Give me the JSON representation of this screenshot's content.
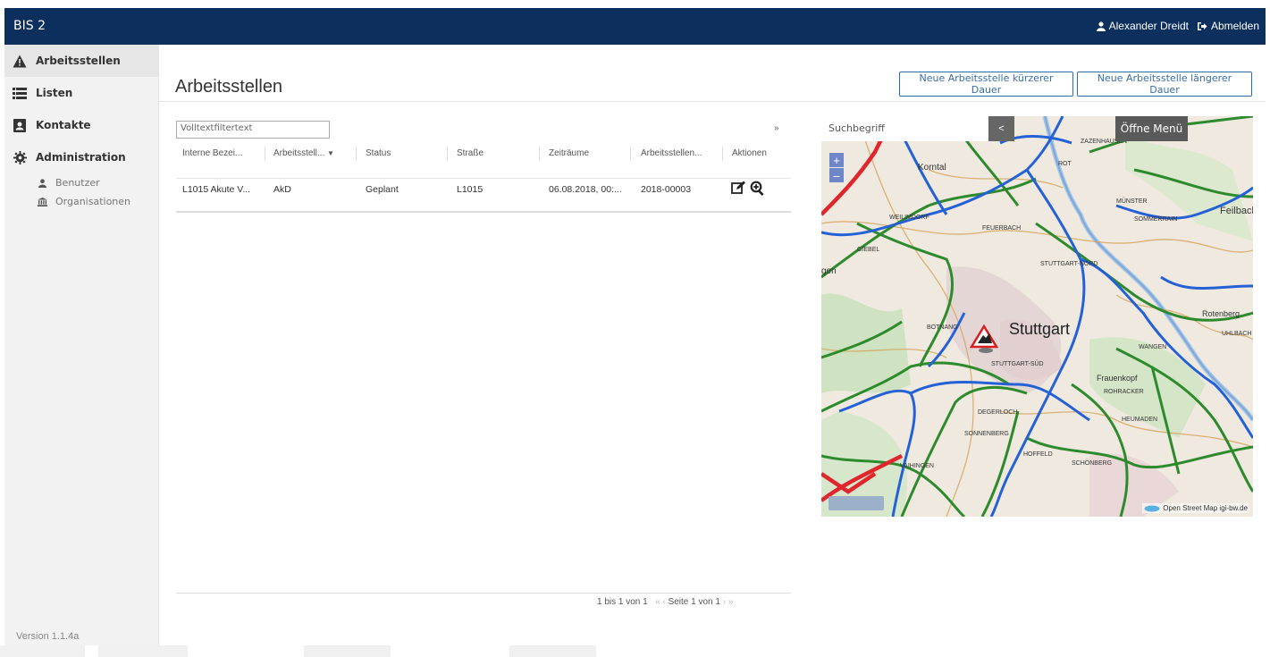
{
  "app": {
    "brand": "BIS 2",
    "user": "Alexander Dreidt",
    "logout": "Abmelden"
  },
  "sidebar": {
    "items": [
      {
        "label": "Arbeitsstellen",
        "icon": "warning-triangle-icon"
      },
      {
        "label": "Listen",
        "icon": "list-icon"
      },
      {
        "label": "Kontakte",
        "icon": "contact-book-icon"
      },
      {
        "label": "Administration",
        "icon": "gear-icon"
      }
    ],
    "sub_items": [
      {
        "label": "Benutzer",
        "icon": "user-icon"
      },
      {
        "label": "Organisationen",
        "icon": "bank-icon"
      }
    ],
    "version": "Version 1.1.4a"
  },
  "page": {
    "title": "Arbeitsstellen",
    "btn_short": "Neue Arbeitsstelle kürzerer Dauer",
    "btn_long": "Neue Arbeitsstelle längerer Dauer"
  },
  "table": {
    "filter_placeholder": "Volltextfiltertext",
    "collapse_icon": "»",
    "columns": [
      "Interne Bezei...",
      "Arbeitsstell...",
      "Status",
      "Straße",
      "Zeiträume",
      "Arbeitsstellen...",
      "Aktionen"
    ],
    "rows": [
      {
        "cells": [
          "L1015 Akute V...",
          "AkD",
          "Geplant",
          "L1015",
          "06.08.2018, 00:...",
          "2018-00003"
        ]
      }
    ],
    "paging": {
      "range": "1 bis 1 von 1",
      "first": "«",
      "prev": "‹",
      "page": "Seite 1 von 1",
      "next": "›",
      "last": "»"
    }
  },
  "map": {
    "search_placeholder": "Suchbegriff",
    "collapse": "<",
    "menu": "Öffne Menü",
    "zoom_in": "+",
    "zoom_out": "–",
    "attribution": "Open Street Map igi-bw.de",
    "city": "Stuttgart",
    "labels": [
      "Korntal",
      "Feilbach",
      "Rotenberg",
      "Frauenkopf",
      "ZAZENHAUSEN",
      "MÜNSTER",
      "ROT",
      "STUTTGART-NORD",
      "STUTTGART-SÜD",
      "HOFFELD",
      "SCHÖNBERG",
      "VAIHINGEN",
      "SONNENBERG",
      "DEGERLOCH",
      "ROHRACKER",
      "WANGEN",
      "UHLBACH",
      "HEUMADEN",
      "FEUERBACH",
      "WEILIMDORF",
      "BOTNANG",
      "SOMMERRAIN",
      "GIEBEL",
      "gen"
    ]
  }
}
